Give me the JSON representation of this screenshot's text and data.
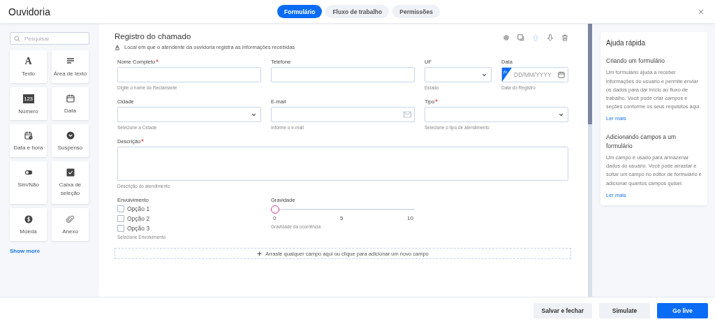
{
  "window": {
    "title": "Ouvidoria"
  },
  "tabs": [
    {
      "label": "Formulário",
      "selected": true
    },
    {
      "label": "Fluxo de trabalho",
      "selected": false
    },
    {
      "label": "Permissões",
      "selected": false
    }
  ],
  "sidebar": {
    "search": {
      "placeholder": "Pesquisar"
    },
    "tools": [
      {
        "label": "Texto",
        "glyph": "A"
      },
      {
        "label": "Área de texto"
      },
      {
        "label": "Número",
        "glyph": "123"
      },
      {
        "label": "Data"
      },
      {
        "label": "Data e hora"
      },
      {
        "label": "Suspenso"
      },
      {
        "label": "Sim/Não"
      },
      {
        "label": "Caixa de seleção"
      },
      {
        "label": "Moeda"
      },
      {
        "label": "Anexo"
      }
    ],
    "show_more": "Show more"
  },
  "form": {
    "title": "Registro do chamado",
    "subtitle": "Local em que o atendente da ouvidoria registra as informações recebidas",
    "actions": [
      {
        "disabled": false
      },
      {
        "disabled": false
      },
      {
        "disabled": true
      },
      {
        "disabled": false
      },
      {
        "disabled": false
      }
    ],
    "rows": [
      [
        {
          "kind": "text",
          "label": "Nome Completo",
          "required": true,
          "hint": "Digite o nome do Reclamante"
        },
        {
          "kind": "text",
          "label": "Telefone",
          "required": false
        },
        {
          "kind": "select",
          "label": "UF",
          "required": false,
          "hint": "Estado"
        },
        {
          "kind": "date",
          "label": "Data",
          "required": false,
          "placeholder": "DD/MM/YYYY",
          "badge": "fx",
          "hint": "Data do Registro"
        }
      ],
      [
        {
          "kind": "select",
          "label": "Cidade",
          "required": false,
          "hint": "Selecione a Cidade"
        },
        {
          "kind": "email",
          "label": "E-mail",
          "required": false,
          "hint": "Informe o e-mail"
        },
        {
          "kind": "select",
          "label": "Tipo",
          "required": true,
          "hint": "Selecione o tipo de atendimento"
        }
      ],
      [
        {
          "kind": "textarea",
          "label": "Descrição",
          "required": true,
          "hint": "Descrição do atendimento"
        }
      ],
      [
        {
          "kind": "checkboxes",
          "label": "Envolvimento",
          "required": false,
          "hint": "Selecione Envolvimento",
          "options": [
            {
              "label": "Opção 1",
              "checked": false
            },
            {
              "label": "Opção 2",
              "checked": false
            },
            {
              "label": "Opção 3",
              "checked": false
            }
          ]
        },
        {
          "kind": "slider",
          "label": "Gravidade",
          "required": false,
          "level": 0,
          "ticks": [
            "0",
            "5",
            "10"
          ],
          "hint": "Gravidade da ocorrência"
        }
      ]
    ],
    "dropzone": "Arraste qualquer campo aqui ou clique para adicionar um novo campo"
  },
  "help": {
    "title": "Ajuda rápida",
    "sections": [
      {
        "heading": "Criando um formulário",
        "body": "Um formulário ajuda a receber informações do usuário e permite enviar os dados para dar início ao fluxo de trabalho. Você pode criar campos e seções conforme os seus requisitos aqui.",
        "link": "Ler mais"
      },
      {
        "heading": "Adicionando campos a um formulário",
        "body": "Um campo é usado para armazenar dados do usuário. Você pode arrastar e soltar um campo no editor de formulário e adicionar quantos campos quiser.",
        "link": "Ler mais"
      }
    ]
  },
  "footer": {
    "buttons": [
      {
        "label": "Salvar e fechar",
        "kind": "secondary"
      },
      {
        "label": "Simulate",
        "kind": "secondary"
      },
      {
        "label": "Go live",
        "kind": "primary"
      }
    ]
  }
}
